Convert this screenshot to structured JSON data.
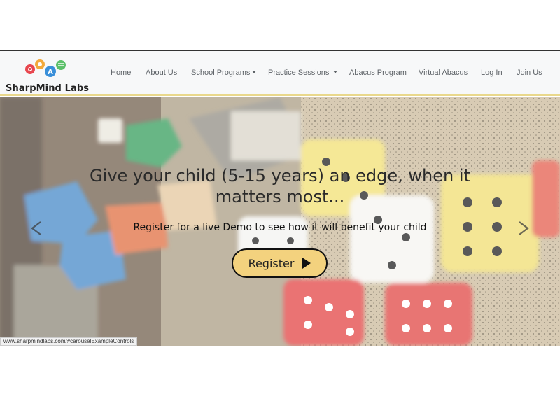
{
  "brand": {
    "name": "SharpMind Labs",
    "logo_letters": [
      "P",
      "A"
    ]
  },
  "nav": {
    "items": [
      {
        "label": "Home",
        "dropdown": false
      },
      {
        "label": "About Us",
        "dropdown": false
      },
      {
        "label": "School Programs",
        "dropdown": true
      },
      {
        "label": "Practice Sessions",
        "dropdown": true
      },
      {
        "label": "Abacus Program",
        "dropdown": false
      },
      {
        "label": "Virtual Abacus",
        "dropdown": false
      },
      {
        "label": "Log In",
        "dropdown": false
      },
      {
        "label": "Join Us",
        "dropdown": false
      }
    ]
  },
  "hero": {
    "title": "Give your child (5-15 years) an edge, when it matters most...",
    "subtitle": "Register for a live Demo to see how it will benefit your child",
    "cta_label": "Register",
    "prev_icon": "chevron-left-icon",
    "next_icon": "chevron-right-icon"
  },
  "status_bar": {
    "url": "www.sharpmindlabs.com/#carouselExampleControls"
  },
  "colors": {
    "cta": "#f3d27e",
    "nav_border": "#e9d88c",
    "nav_bg": "#f7f8f9"
  }
}
